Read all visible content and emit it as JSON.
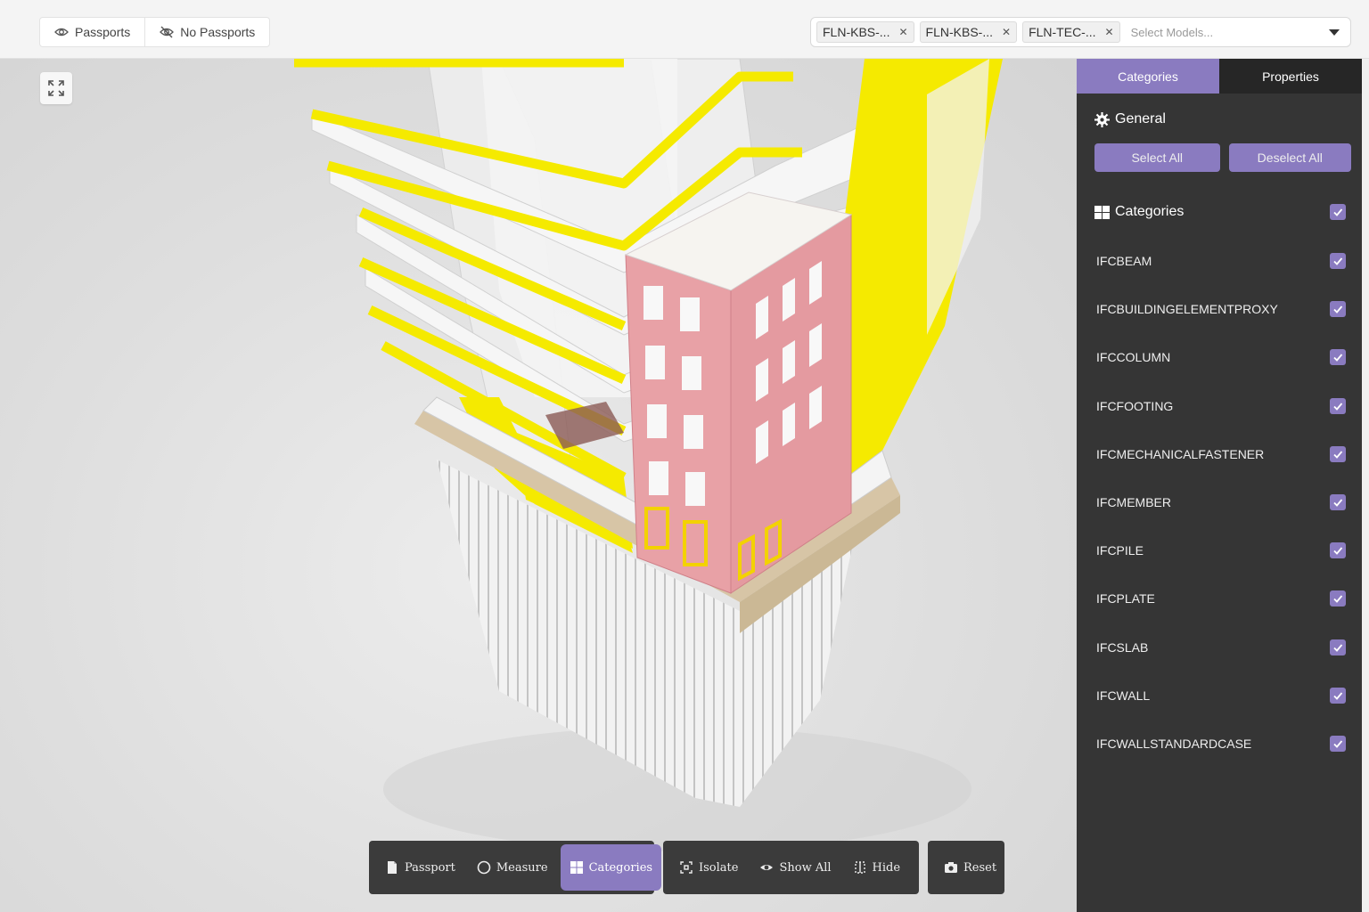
{
  "topbar": {
    "passports_label": "Passports",
    "no_passports_label": "No Passports",
    "models": {
      "chips": [
        {
          "label": "FLN-KBS-..."
        },
        {
          "label": "FLN-KBS-..."
        },
        {
          "label": "FLN-TEC-..."
        }
      ],
      "placeholder": "Select Models..."
    }
  },
  "toolbar": {
    "passport": "Passport",
    "measure": "Measure",
    "categories": "Categories",
    "isolate": "Isolate",
    "show_all": "Show All",
    "hide": "Hide",
    "reset": "Reset"
  },
  "panel": {
    "tabs": {
      "categories": "Categories",
      "properties": "Properties"
    },
    "general": {
      "title": "General",
      "select_all": "Select All",
      "deselect_all": "Deselect All"
    },
    "categories": {
      "title": "Categories",
      "items": [
        {
          "label": "IFCBEAM",
          "checked": true
        },
        {
          "label": "IFCBUILDINGELEMENTPROXY",
          "checked": true
        },
        {
          "label": "IFCCOLUMN",
          "checked": true
        },
        {
          "label": "IFCFOOTING",
          "checked": true
        },
        {
          "label": "IFCMECHANICALFASTENER",
          "checked": true
        },
        {
          "label": "IFCMEMBER",
          "checked": true
        },
        {
          "label": "IFCPILE",
          "checked": true
        },
        {
          "label": "IFCPLATE",
          "checked": true
        },
        {
          "label": "IFCSLAB",
          "checked": true
        },
        {
          "label": "IFCWALL",
          "checked": true
        },
        {
          "label": "IFCWALLSTANDARDCASE",
          "checked": true
        }
      ]
    }
  },
  "colors": {
    "accent": "#8a7bc0",
    "panel_bg": "#353535",
    "highlight_yellow": "#f5ea00",
    "brick_pink": "#e8a1a6"
  }
}
